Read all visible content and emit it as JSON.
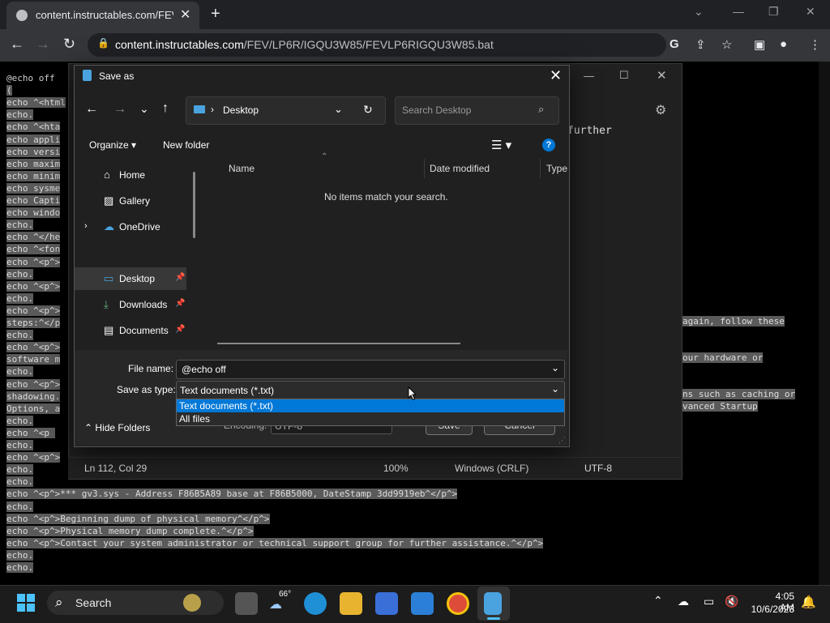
{
  "browser": {
    "tab_title": "content.instructables.com/FEV/L",
    "url_host": "content.instructables.com",
    "url_path": "/FEV/LP6R/IGQU3W85/FEVLP6RIGQU3W85.bat"
  },
  "page_lines": [
    "@echo off",
    "(",
    "echo ^<html",
    "echo.",
    "echo ^<hta",
    "echo appli",
    "echo versi",
    "echo maxim",
    "echo minim",
    "echo sysme",
    "echo Capti",
    "echo windo",
    "echo.",
    "echo ^</he",
    "echo ^<fon",
    "echo ^<p^>",
    "echo.",
    "echo ^<p^>",
    "echo.",
    "echo ^<p^>",
    "steps:^</p",
    "echo.",
    "echo ^<p^>",
    "software m",
    "echo.",
    "echo ^<p^>",
    "shadowing.",
    "Options, a",
    "echo.",
    "echo ^<p ",
    "echo.",
    "echo ^<p^>",
    "echo.",
    "echo.",
    "echo ^<p^>*** gv3.sys - Address F86B5A89 base at F86B5000, DateStamp 3dd9919eb^</p^>",
    "echo.",
    "echo ^<p^>Beginning dump of physical memory^</p^>",
    "echo ^<p^>Physical memory dump complete.^</p^>",
    "echo ^<p^>Contact your system administrator or technical support group for further assistance.^</p^>",
    "echo.",
    "echo."
  ],
  "page_right_fragments": [
    "again, follow these",
    "our hardware or",
    "ns such as caching or",
    "vanced Startup"
  ],
  "notepad": {
    "partial_text": "further",
    "status": {
      "position": "Ln 112, Col 29",
      "zoom": "100%",
      "line_endings": "Windows (CRLF)",
      "encoding": "UTF-8"
    }
  },
  "dialog": {
    "title": "Save as",
    "location": "Desktop",
    "search_placeholder": "Search Desktop",
    "organize_label": "Organize",
    "new_folder_label": "New folder",
    "nav_items": [
      {
        "label": "Home",
        "icon": "home-icon"
      },
      {
        "label": "Gallery",
        "icon": "gallery-icon"
      },
      {
        "label": "OneDrive",
        "icon": "cloud-icon"
      },
      {
        "label": "Desktop",
        "icon": "desktop-icon"
      },
      {
        "label": "Downloads",
        "icon": "download-icon"
      },
      {
        "label": "Documents",
        "icon": "document-icon"
      }
    ],
    "columns": [
      "Name",
      "Date modified",
      "Type"
    ],
    "empty_message": "No items match your search.",
    "file_name_label": "File name:",
    "file_name_value": "@echo off",
    "save_type_label": "Save as type:",
    "save_type_value": "Text documents (*.txt)",
    "type_options": [
      "Text documents (*.txt)",
      "All files"
    ],
    "hide_folders_label": "Hide Folders",
    "encoding_label": "Encoding:",
    "encoding_value": "UTF-8",
    "save_label": "Save",
    "cancel_label": "Cancel"
  },
  "taskbar": {
    "search_label": "Search",
    "weather_temp": "66°",
    "time": "4:05 AM",
    "date": "10/6/2023"
  },
  "colors": {
    "accent": "#0078d7",
    "chrome_bg": "#202124",
    "toolbar_bg": "#35363a",
    "dialog_bg": "#202020"
  }
}
